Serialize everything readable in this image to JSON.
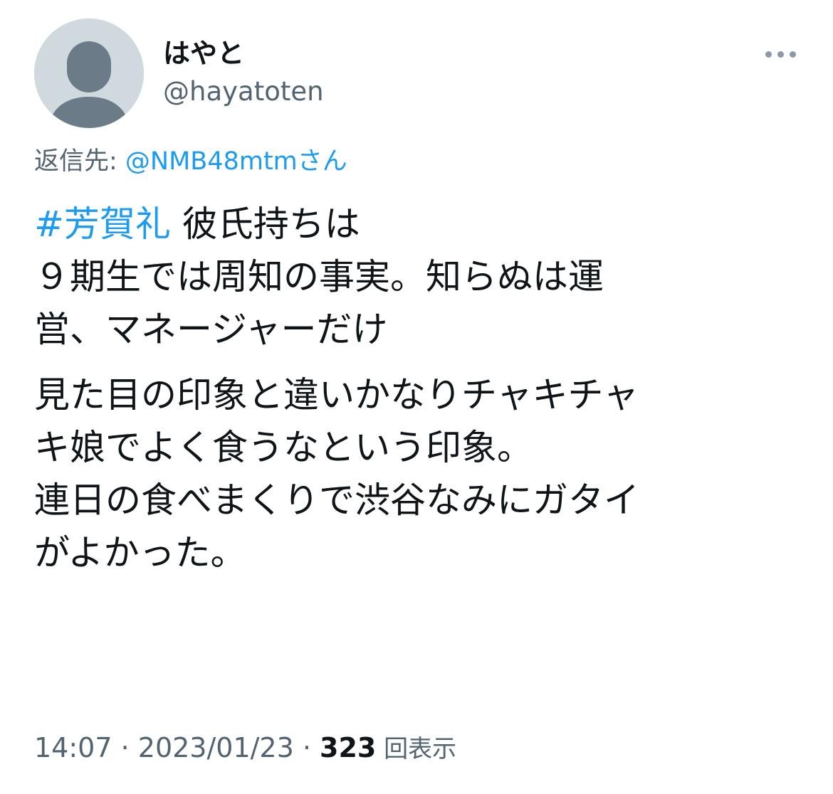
{
  "author": {
    "display_name": "はやと",
    "handle": "@hayatoten",
    "avatar_icon": "default-person-icon"
  },
  "menu": {
    "more_icon": "more-horizontal-icon"
  },
  "reply": {
    "label": "返信先: ",
    "mention": "@NMB48mtm",
    "suffix": "さん"
  },
  "tweet": {
    "hashtag": "#芳賀礼",
    "line1_rest": " 彼氏持ちは",
    "line2": "９期生では周知の事実。知らぬは運",
    "line3": "営、マネージャーだけ",
    "line4": "見た目の印象と違いかなりチャキチャ",
    "line5": "キ娘でよく食うなという印象。",
    "line6": "連日の食べまくりで渋谷なみにガタイ",
    "line7": "がよかった。"
  },
  "meta": {
    "time": "14:07",
    "separator1": " · ",
    "date": "2023/01/23",
    "separator2": " · ",
    "views_count": "323",
    "views_label": " 回表示"
  },
  "colors": {
    "accent": "#1d9bf0",
    "text": "#0f1419",
    "secondary": "#536471",
    "avatar_bg": "#cfd9de",
    "avatar_fg": "#6b7b88"
  }
}
